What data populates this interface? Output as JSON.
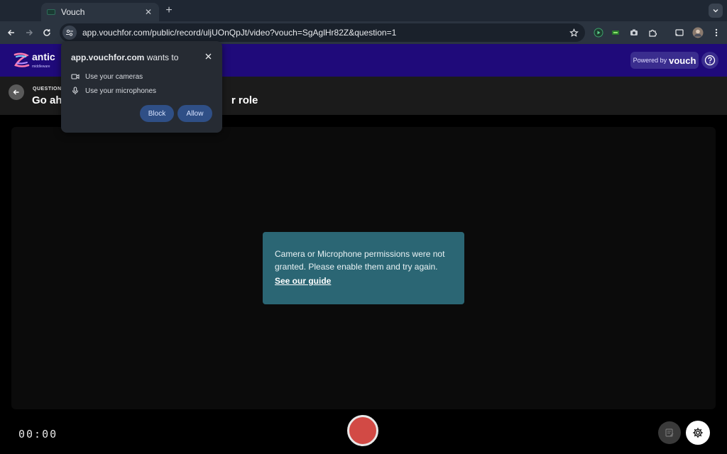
{
  "browser": {
    "tab_title": "Vouch",
    "new_tab": "+",
    "url": "app.vouchfor.com/public/record/uljUOnQpJt/video?vouch=SgAglHr82Z&question=1"
  },
  "header": {
    "logo_text": "antic",
    "logo_sub": "middleware",
    "powered_prefix": "Powered by",
    "powered_brand": "vouch"
  },
  "question": {
    "label": "QUESTION 1",
    "title_start": "Go ahe",
    "title_end": "r role"
  },
  "alert": {
    "message": "Camera or Microphone permissions were not granted. Please enable them and try again.",
    "link": "See our guide"
  },
  "controls": {
    "timer": "00:00"
  },
  "permission": {
    "site": "app.vouchfor.com",
    "suffix": " wants to",
    "items": [
      "Use your cameras",
      "Use your microphones"
    ],
    "block": "Block",
    "allow": "Allow"
  },
  "colors": {
    "header_bg": "#1f0a7a",
    "alert_bg": "#2b6674",
    "record": "#d24a45"
  }
}
